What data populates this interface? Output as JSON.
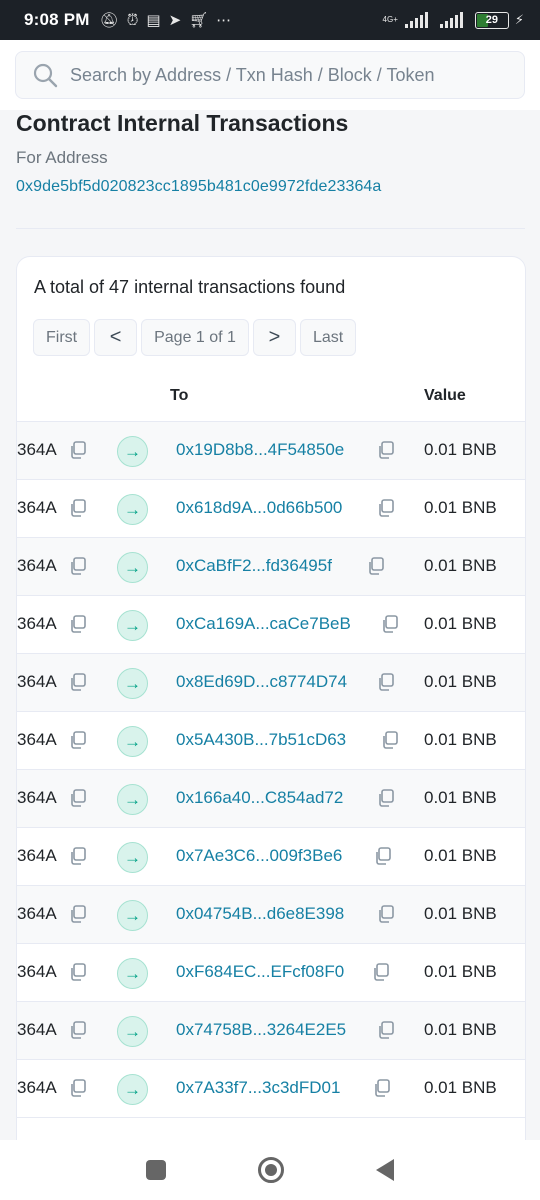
{
  "status_bar": {
    "time": "9:08 PM",
    "notification_icons": [
      "muted-bell-icon",
      "alarm-icon",
      "news-icon",
      "telegram-icon",
      "cart-icon",
      "more-dots-icon"
    ],
    "network_label": "4G+",
    "battery_level": "29"
  },
  "search": {
    "placeholder": "Search by Address / Txn Hash / Block / Token"
  },
  "header": {
    "title": "Contract Internal Transactions",
    "subtitle": "For Address",
    "address": "0x9de5bf5d020823cc1895b481c0e9972fde23364a"
  },
  "summary": {
    "text": "A total of 47 internal transactions found"
  },
  "pagination": {
    "first": "First",
    "prev": "<",
    "page": "Page 1 of 1",
    "next": ">",
    "last": "Last"
  },
  "table": {
    "columns": {
      "to": "To",
      "value": "Value"
    },
    "rows": [
      {
        "from": "364A",
        "to": "0x19D8b8...4F54850e",
        "value": "0.01 BNB"
      },
      {
        "from": "364A",
        "to": "0x618d9A...0d66b500",
        "value": "0.01 BNB"
      },
      {
        "from": "364A",
        "to": "0xCaBfF2...fd36495f",
        "value": "0.01 BNB"
      },
      {
        "from": "364A",
        "to": "0xCa169A...caCe7BeB",
        "value": "0.01 BNB"
      },
      {
        "from": "364A",
        "to": "0x8Ed69D...c8774D74",
        "value": "0.01 BNB"
      },
      {
        "from": "364A",
        "to": "0x5A430B...7b51cD63",
        "value": "0.01 BNB"
      },
      {
        "from": "364A",
        "to": "0x166a40...C854ad72",
        "value": "0.01 BNB"
      },
      {
        "from": "364A",
        "to": "0x7Ae3C6...009f3Be6",
        "value": "0.01 BNB"
      },
      {
        "from": "364A",
        "to": "0x04754B...d6e8E398",
        "value": "0.01 BNB"
      },
      {
        "from": "364A",
        "to": "0xF684EC...EFcf08F0",
        "value": "0.01 BNB"
      },
      {
        "from": "364A",
        "to": "0x74758B...3264E2E5",
        "value": "0.01 BNB"
      },
      {
        "from": "364A",
        "to": "0x7A33f7...3c3dFD01",
        "value": "0.01 BNB"
      }
    ]
  },
  "colors": {
    "link": "#1680a4",
    "arrow_badge_bg": "#d9f3ec",
    "arrow_badge_fg": "#00a186"
  }
}
